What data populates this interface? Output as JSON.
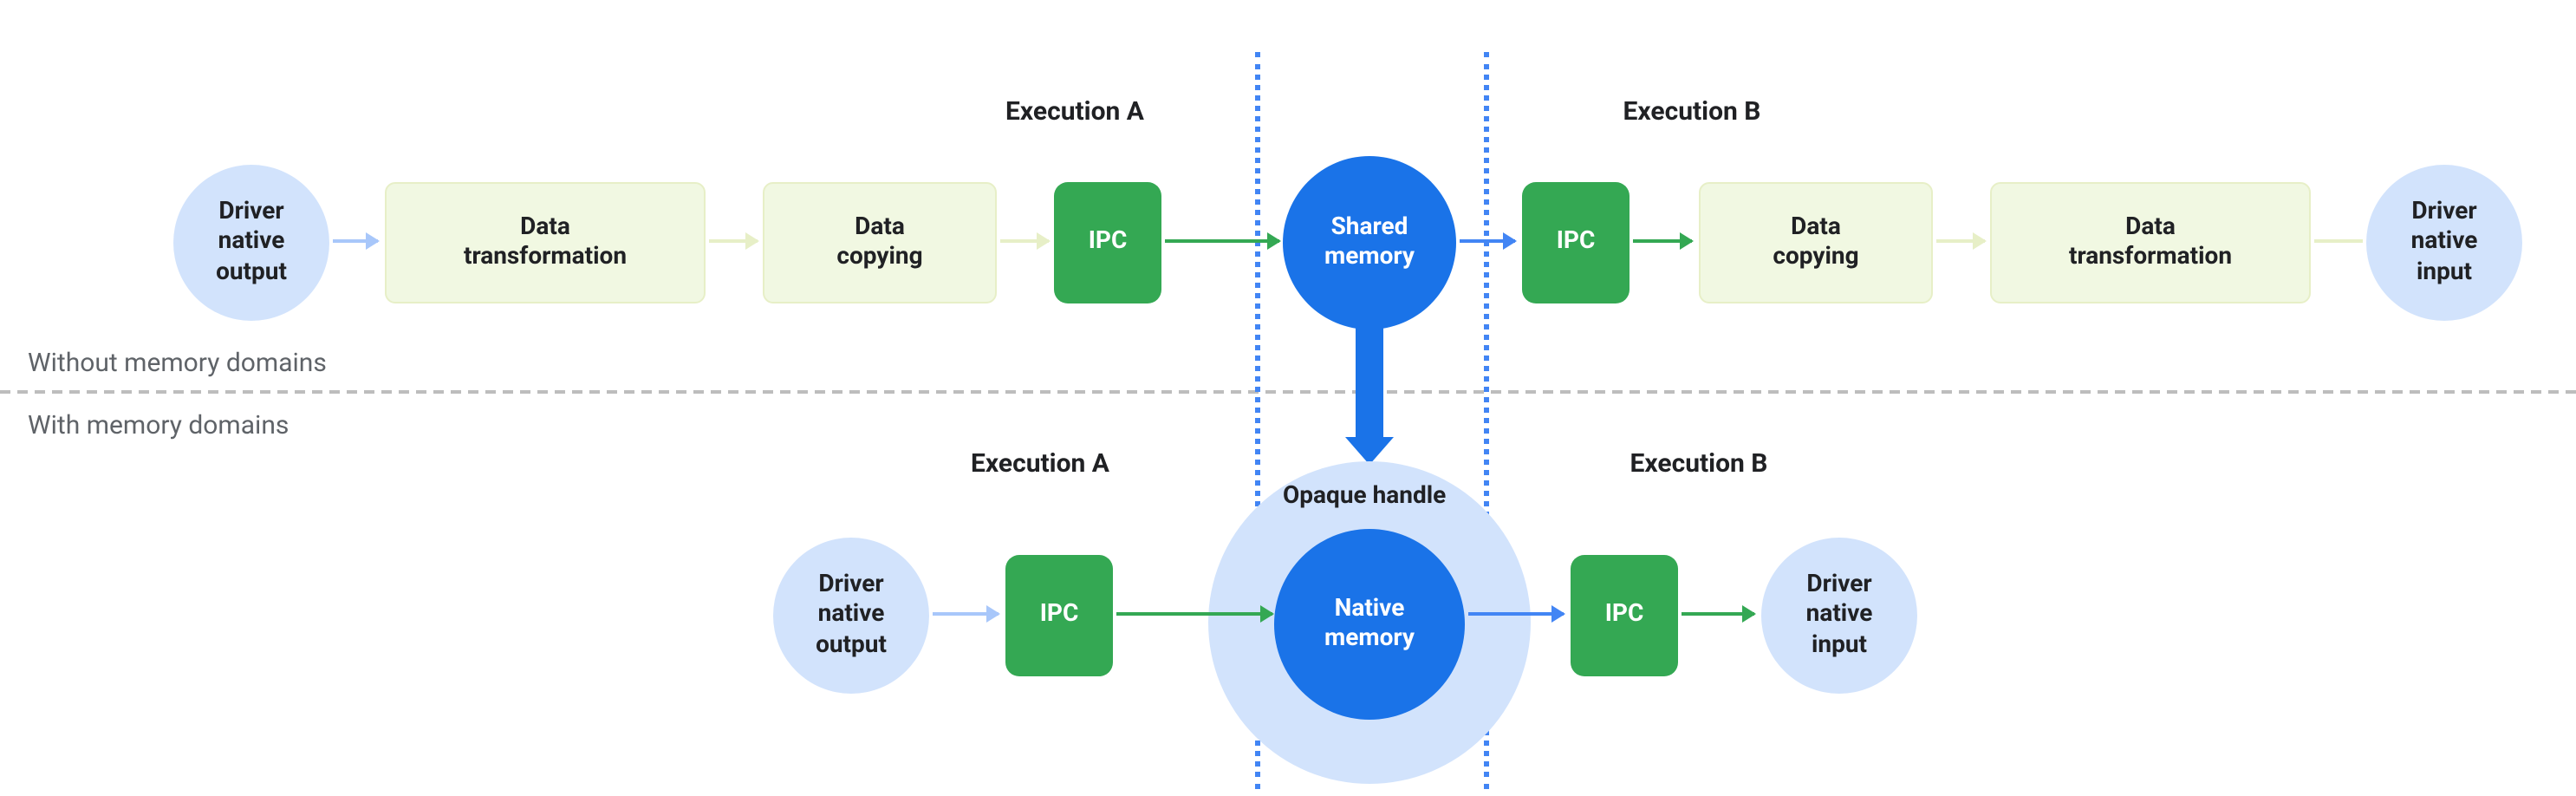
{
  "labels": {
    "without": "Without memory domains",
    "with": "With memory domains",
    "execA": "Execution A",
    "execB": "Execution B",
    "opaque": "Opaque handle"
  },
  "top": {
    "driverOut": "Driver\nnative\noutput",
    "transformA": "Data\ntransformation",
    "copyA": "Data\ncopying",
    "ipcA": "IPC",
    "shared": "Shared\nmemory",
    "ipcB": "IPC",
    "copyB": "Data\ncopying",
    "transformB": "Data\ntransformation",
    "driverIn": "Driver\nnative\ninput"
  },
  "bottom": {
    "driverOut": "Driver\nnative\noutput",
    "ipcA": "IPC",
    "native": "Native\nmemory",
    "ipcB": "IPC",
    "driverIn": "Driver\nnative\ninput"
  }
}
